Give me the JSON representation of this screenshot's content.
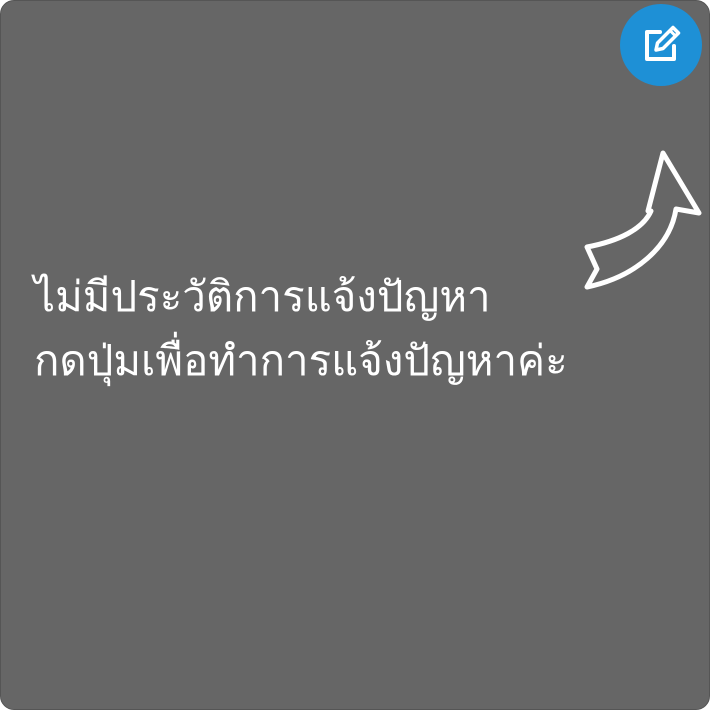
{
  "empty_state": {
    "line1": "ไม่มีประวัติการแจ้งปัญหา",
    "line2": "กดปุ่มเพื่อทำการแจ้งปัญหาค่ะ"
  },
  "edit_button": {
    "icon": "edit-icon"
  },
  "colors": {
    "panel_background": "#666666",
    "text": "#ffffff",
    "accent": "#1e90d6"
  }
}
